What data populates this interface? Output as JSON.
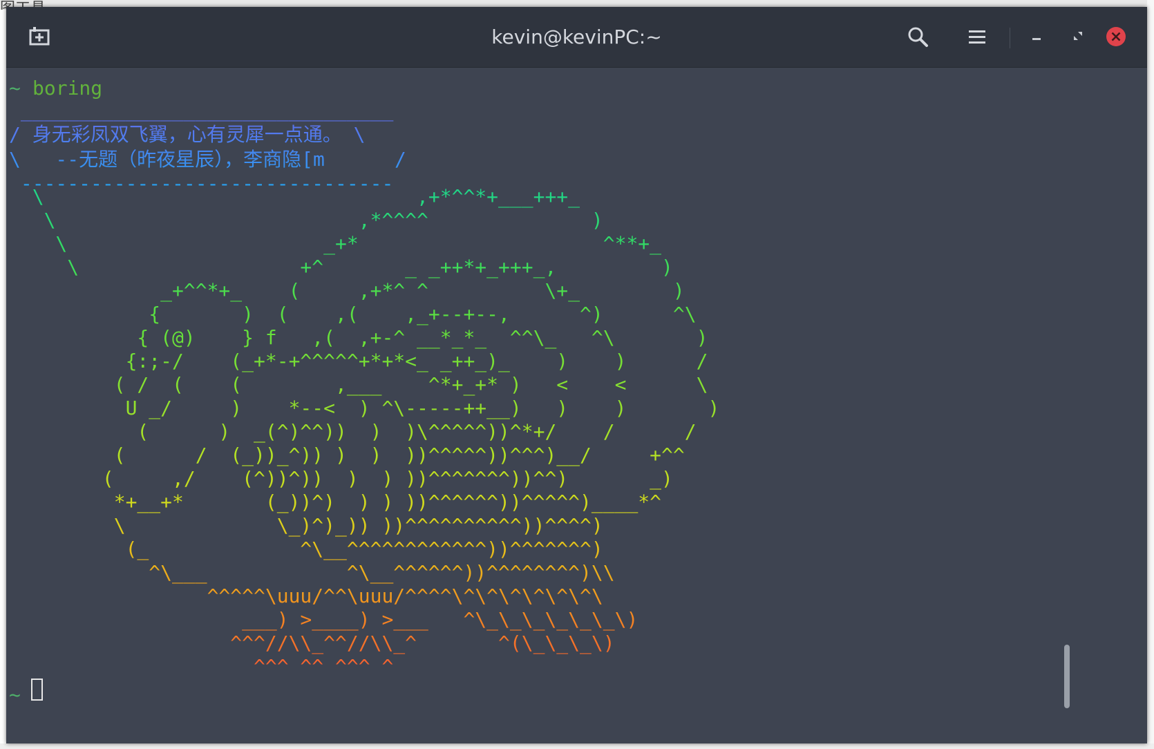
{
  "background": {
    "partial_label": "图工具"
  },
  "window": {
    "title": "kevin@kevinPC:~",
    "titlebar_color": "#2f343e",
    "background_color": "#3e4451",
    "close_color": "#e0434b",
    "icons": {
      "new_tab": "new-tab-icon",
      "search": "search-icon",
      "menu": "hamburger-menu-icon",
      "minimize": "minimize-icon",
      "restore": "restore-icon",
      "close": "close-icon"
    }
  },
  "terminal": {
    "prompt_symbol": "~",
    "command": "boring",
    "cowsay_text": " ________________________________\n/ 身无彩凤双飞翼，心有灵犀一点通。 \\\n\\   --无题（昨夜星辰），李商隐[m      /\n --------------------------------",
    "ascii_art": "  \\                                ,+*^^*+___+++_\n   \\                          ,*^^^^              )\n    \\                      _+*                     ^**+_\n     \\                   +^       _ _++*+_+++_,         )\n             _+^^*+_    (     ,+*^ ^          \\+_        )\n            {       )  (    ,(    ,_+--+--,      ^)      ^\\\n           { (@)    } f   ,(  ,+-^ __*_*_  ^^\\_   ^\\       )\n          {:;-/    (_+*-+^^^^^+*+*<_ _++_)_    )    )      /\n         ( /  (    (        ,___    ^*+_+* )   <    <      \\\n          U _/     )    *--<  ) ^\\-----++__)   )    )       )\n           (      )  _(^)^^))  )  )\\^^^^^))^*+/    /      /\n         (      /  (_))_^)) )  )  ))^^^^^))^^^)__/     +^^\n        (     ,/    (^))^))  )  ) ))^^^^^^^))^^)       _)\n         *+__+*       (_))^)  ) ) ))^^^^^^))^^^^^)____*^\n         \\             \\_)^)_)) ))^^^^^^^^^^))^^^^)\n          (_             ^\\__^^^^^^^^^^^^))^^^^^^^)\n            ^\\___            ^\\__^^^^^^))^^^^^^^^)\\\\\n                 ^^^^^\\uuu/^^\\uuu/^^^^\\^\\^\\^\\^\\^\\^\\\n                    ___) >____) >___   ^\\_\\_\\_\\_\\_\\_\\)\n                   ^^^//\\\\_^^//\\\\_^       ^(\\_\\_\\_\\)\n                     ^^^ ^^ ^^^ ^"
  }
}
